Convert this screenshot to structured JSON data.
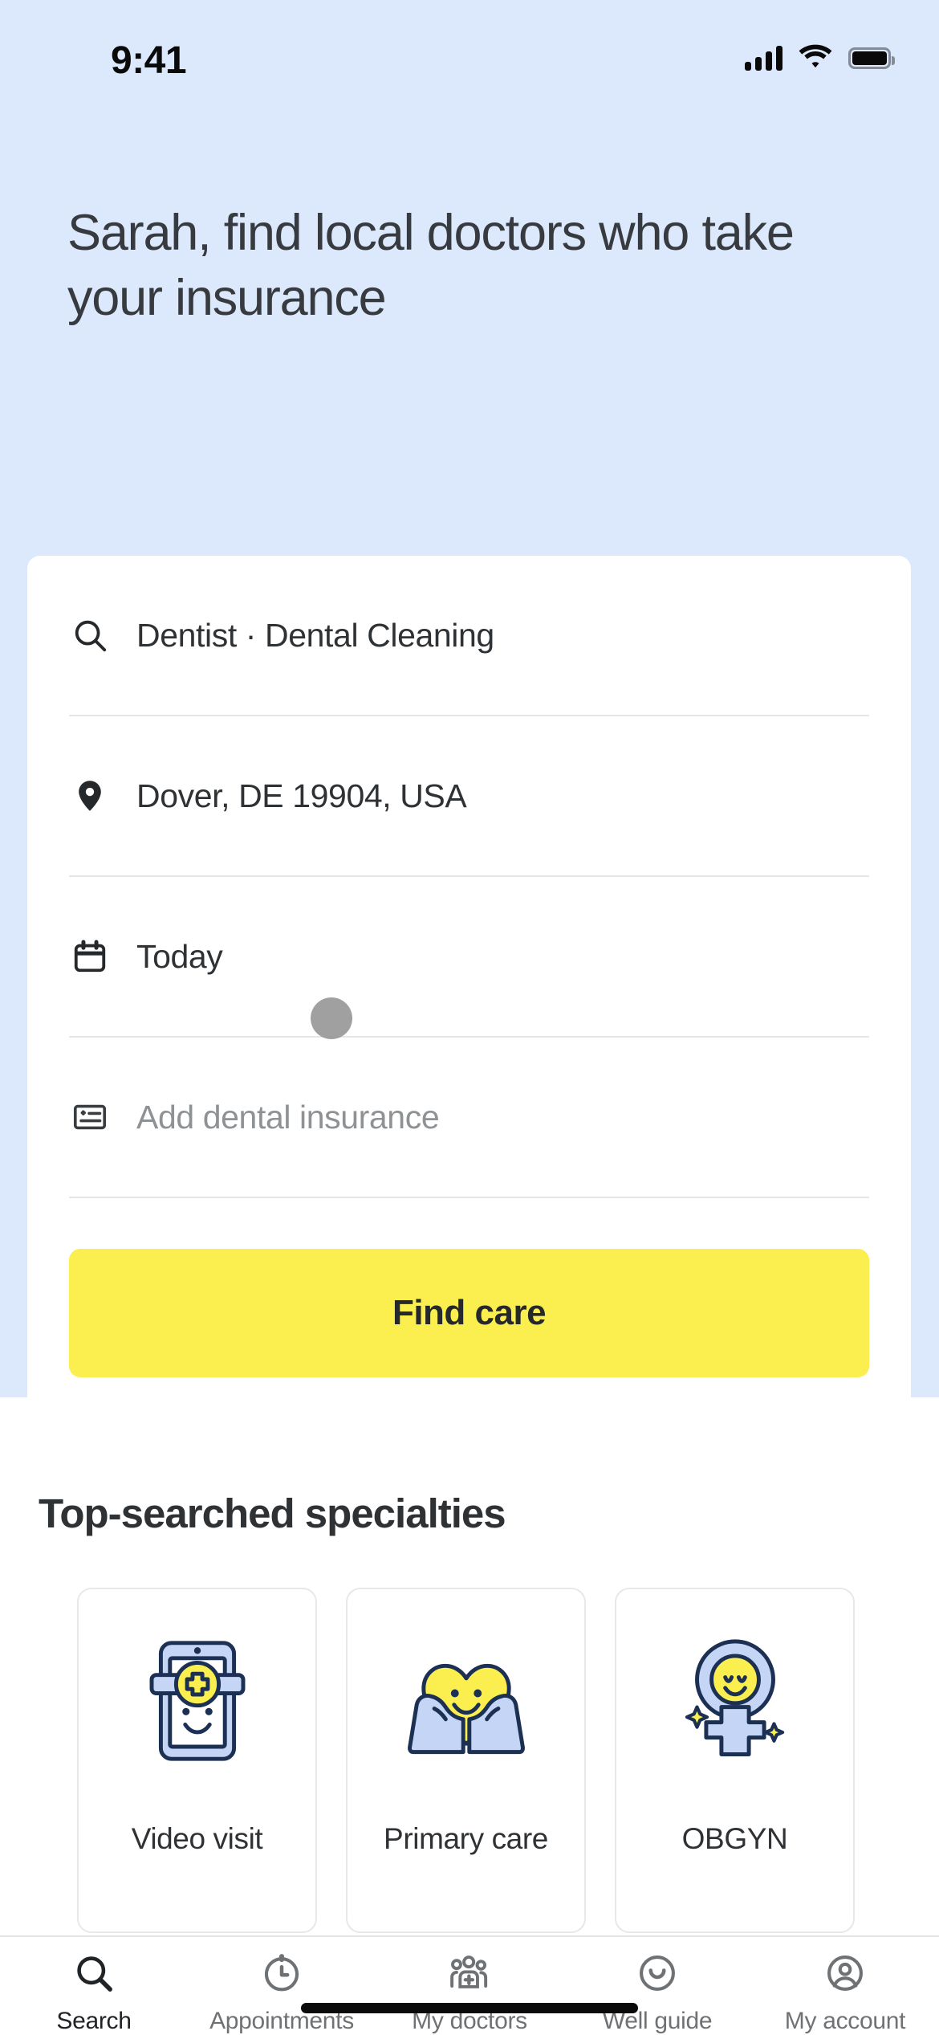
{
  "status_bar": {
    "time": "9:41",
    "cellular_icon": "cellular-signal-icon",
    "wifi_icon": "wifi-icon",
    "battery_icon": "battery-full-icon"
  },
  "header": {
    "headline": "Sarah, find local doctors who take your insurance",
    "background_color": "#dce8fb"
  },
  "search_card": {
    "fields": [
      {
        "icon": "search-icon",
        "value": "Dentist · Dental Cleaning",
        "is_placeholder": false
      },
      {
        "icon": "location-pin-icon",
        "value": "Dover, DE 19904, USA",
        "is_placeholder": false
      },
      {
        "icon": "calendar-icon",
        "value": "Today",
        "is_placeholder": false
      },
      {
        "icon": "insurance-card-icon",
        "value": "Add dental insurance",
        "is_placeholder": true
      }
    ],
    "submit_label": "Find care",
    "submit_color": "#fbef50",
    "tap_indicator_color": "#989898"
  },
  "specialties": {
    "title": "Top-searched specialties",
    "items": [
      {
        "label": "Video visit",
        "art": "phone-smiley-cross-illustration"
      },
      {
        "label": "Primary care",
        "art": "hands-holding-heart-illustration"
      },
      {
        "label": "OBGYN",
        "art": "female-symbol-smiley-illustration"
      }
    ]
  },
  "tab_bar": {
    "items": [
      {
        "label": "Search",
        "icon": "search-icon",
        "active": true
      },
      {
        "label": "Appointments",
        "icon": "clock-icon",
        "active": false
      },
      {
        "label": "My doctors",
        "icon": "people-plus-icon",
        "active": false
      },
      {
        "label": "Well guide",
        "icon": "smiley-circle-icon",
        "active": false
      },
      {
        "label": "My account",
        "icon": "account-avatar-icon",
        "active": false
      }
    ]
  },
  "palette": {
    "hero_blue": "#dce8fb",
    "accent_yellow": "#fbef50",
    "illustration_blue": "#c5d5f5",
    "illustration_outline": "#1c3054",
    "text_dark": "#2f3235",
    "text_muted": "#8e9295"
  }
}
